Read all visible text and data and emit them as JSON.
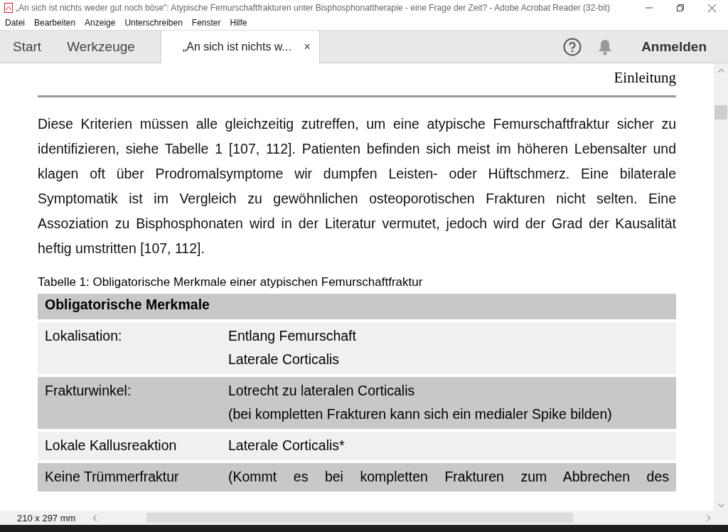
{
  "window": {
    "title": "„An sich ist nichts weder gut noch böse\": Atypische Femurschaftfrakturen unter Bisphosphonattherapie - eine Frage der Zeit? - Adobe Acrobat Reader (32-bit)"
  },
  "menu": [
    "Datei",
    "Bearbeiten",
    "Anzeige",
    "Unterschreiben",
    "Fenster",
    "Hilfe"
  ],
  "tabs": [
    {
      "label": "Start",
      "selected": false
    },
    {
      "label": "Werkzeuge",
      "selected": false
    },
    {
      "label": "„An sich ist nichts w...",
      "selected": true,
      "close": "×"
    }
  ],
  "toolbar": {
    "sign_in": "Anmelden"
  },
  "document": {
    "running_head": "Einleitung",
    "paragraph": "Diese Kriterien müssen alle gleichzeitig zutreffen, um eine atypische Femurschaftfraktur sicher zu identifizieren, siehe Tabelle 1 [107, 112]. Patienten befinden sich meist im höheren Lebensalter und klagen oft über Prodromalsymptome wir dumpfen Leisten- oder Hüftschmerz. Eine bilaterale Symptomatik ist im Vergleich zu gewöhnlichen osteoporotischen Frakturen nicht selten. Eine Assoziation zu Bisphosphonaten wird in der Literatur vermutet, jedoch wird der Grad der Kausalität heftig umstritten [107, 112].",
    "table": {
      "caption": "Tabelle 1: Obligatorische Merkmale einer atypischen Femurschaftfraktur",
      "header": "Obligatorische Merkmale",
      "rows": [
        {
          "label": "Lokalisation:",
          "values": [
            "Entlang Femurschaft",
            "Laterale Corticalis"
          ]
        },
        {
          "label": "Frakturwinkel:",
          "values": [
            "Lotrecht zu lateralen Corticalis",
            "(bei kompletten Frakturen kann sich ein medialer Spike bilden)"
          ]
        },
        {
          "label": "Lokale Kallusreaktion",
          "values": [
            "Laterale Corticalis*"
          ]
        },
        {
          "label": "Keine Trümmerfraktur",
          "values": [
            "(Kommt es bei kompletten Frakturen zum Abbrechen des"
          ]
        }
      ]
    }
  },
  "status_bar": {
    "page_size": "210 x 297 mm"
  }
}
